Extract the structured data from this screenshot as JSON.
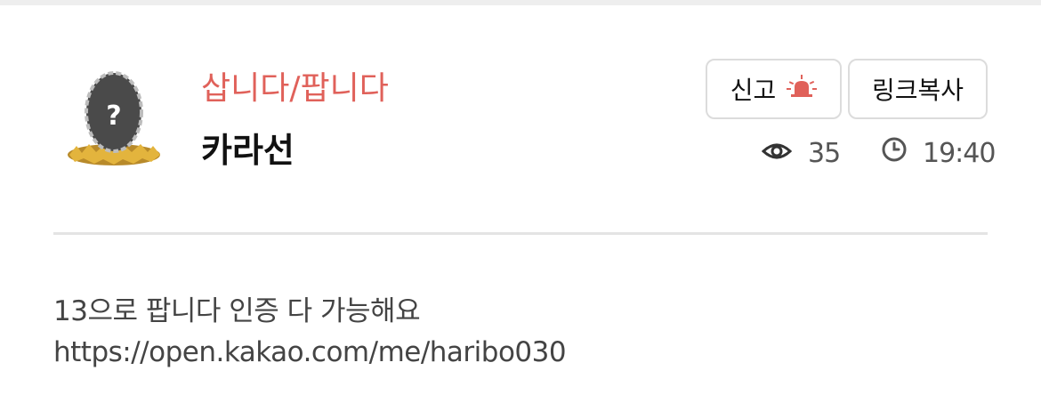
{
  "post": {
    "category": "삽니다/팝니다",
    "author": "카라선",
    "views": "35",
    "time": "19:40",
    "body_lines": [
      "13으로 팝니다 인증 다 가능해요",
      "https://open.kakao.com/me/haribo030"
    ]
  },
  "actions": {
    "report_label": "신고",
    "copy_link_label": "링크복사"
  },
  "icons": {
    "avatar": "mystery-egg-avatar",
    "report": "siren-icon",
    "views": "eye-icon",
    "time": "clock-icon"
  },
  "colors": {
    "category": "#e0615a",
    "report_icon": "#e0615a",
    "text_primary": "#111111",
    "text_secondary": "#555555",
    "border": "#dcdcdc"
  }
}
